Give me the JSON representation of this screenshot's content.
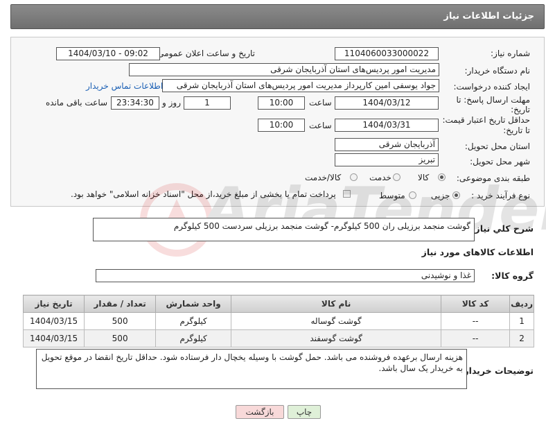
{
  "header": {
    "title": "جزئیات اطلاعات نیاز"
  },
  "form": {
    "need_number_label": "شماره نیاز:",
    "need_number": "1104060033000022",
    "announce_label": "تاریخ و ساعت اعلان عمومی:",
    "announce_value": "1404/03/10 - 09:02",
    "buyer_label": "نام دستگاه خریدار:",
    "buyer_value": "مدیریت امور پردیس‌های استان آذربایجان شرقی",
    "creator_label": "ایجاد کننده درخواست:",
    "creator_value": "جواد یوسفی امین کارپرداز مدیریت امور پردیس‌های استان آذربایجان شرقی",
    "contact_link": "اطلاعات تماس خریدار",
    "deadline_label_1": "مهلت ارسال پاسخ: تا",
    "deadline_label_2": "تاریخ:",
    "deadline_date": "1404/03/12",
    "time_label": "ساعت",
    "deadline_time": "10:00",
    "days_value": "1",
    "days_label": "روز و",
    "remaining_time": "23:34:30",
    "remaining_label": "ساعت باقی مانده",
    "validity_label_1": "حداقل تاریخ اعتبار قیمت:",
    "validity_label_2": "تا تاریخ:",
    "validity_date": "1404/03/31",
    "validity_time_label": "ساعت",
    "validity_time": "10:00",
    "province_label": "استان محل تحویل:",
    "province_value": "آذربایجان شرقی",
    "city_label": "شهر محل تحویل:",
    "city_value": "تبریز",
    "category_label": "طبقه بندی موضوعی:",
    "category_options": [
      "کالا",
      "خدمت",
      "کالا/خدمت"
    ],
    "category_selected": "کالا",
    "process_label": "نوع فرآیند خرید :",
    "process_options": [
      "جزیی",
      "متوسط"
    ],
    "process_selected": "جزیی",
    "payment_note": "پرداخت تمام یا بخشی از مبلغ خرید،از محل \"اسناد خزانه اسلامی\" خواهد بود."
  },
  "summary": {
    "label": "شرح كلي نياز:",
    "value": "گوشت منجمد برزیلی ران 500 کیلوگرم- گوشت منجمد برزیلی سردست 500 کیلوگرم"
  },
  "goods": {
    "section_title": "اطلاعات کالاهای مورد نیاز",
    "group_label": "گروه کالا:",
    "group_value": "غذا و نوشیدنی",
    "columns": [
      "ردیف",
      "کد کالا",
      "نام کالا",
      "واحد شمارش",
      "تعداد / مقدار",
      "تاریخ نیاز"
    ],
    "rows": [
      [
        "1",
        "--",
        "گوشت گوساله",
        "کیلوگرم",
        "500",
        "1404/03/15"
      ],
      [
        "2",
        "--",
        "گوشت گوسفند",
        "کیلوگرم",
        "500",
        "1404/03/15"
      ]
    ]
  },
  "notes": {
    "label": "توضیحات خریدار:",
    "value": "هزینه ارسال برعهده فروشنده می باشد. حمل گوشت با وسیله یخچال دار فرستاده شود. حداقل تاریخ انقضا در موقع تحویل به خریدار یک سال باشد."
  },
  "buttons": {
    "print": "چاپ",
    "back": "بازگشت"
  },
  "watermark": {
    "text": "AriaTender.neT"
  },
  "colors": {
    "header_bg": "#7a7a7a",
    "link": "#1a5fb4",
    "back_btn": "#f8d9d9",
    "print_btn": "#dff0d8"
  }
}
